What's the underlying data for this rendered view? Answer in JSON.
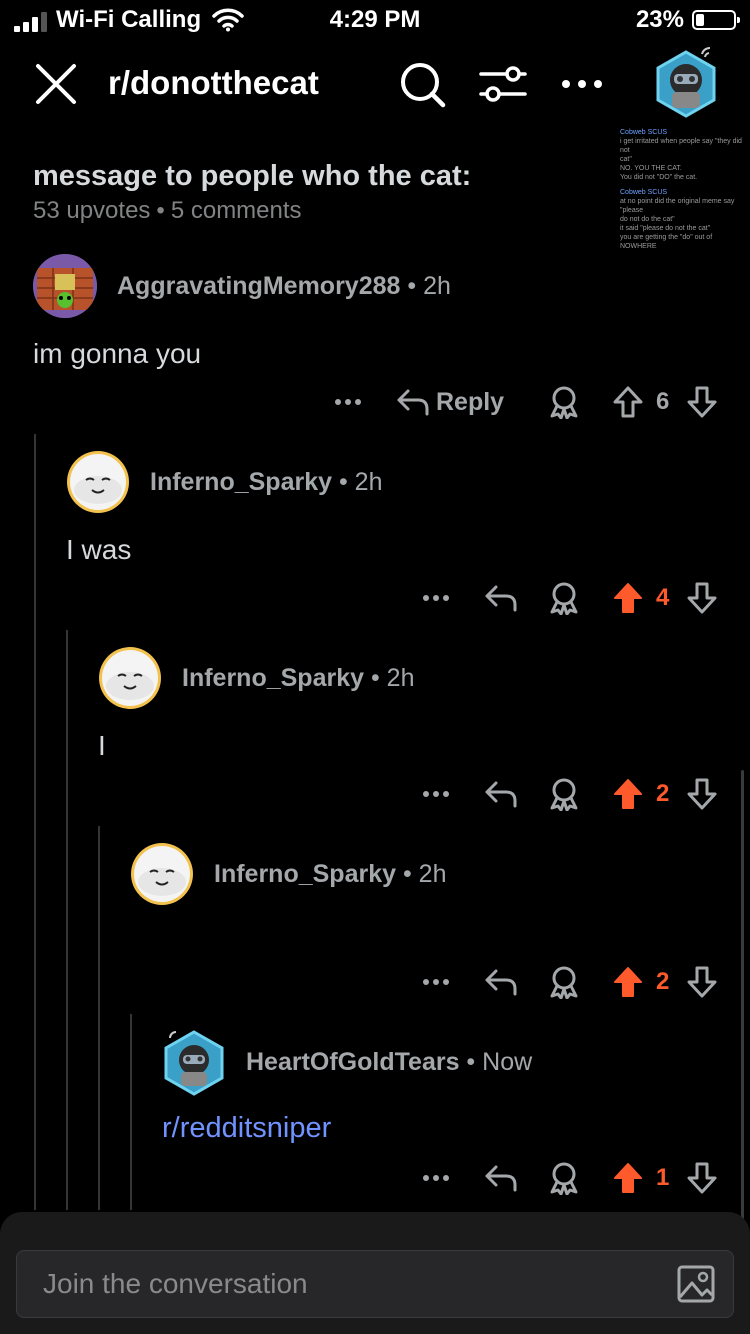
{
  "status_bar": {
    "carrier": "Wi-Fi Calling",
    "time": "4:29 PM",
    "battery": "23%"
  },
  "header": {
    "subreddit": "r/donotthecat"
  },
  "post": {
    "title": "message to people who the cat:",
    "upvotes": "53 upvotes",
    "comments": "5 comments",
    "thumbnail": {
      "lines": [
        "Cobweb  SCUS",
        "i get irritated when people say \"they did not",
        "cat\"",
        "NO. YOU THE CAT.",
        "You did not \"DO\" the cat.",
        "Cobweb  SCUS",
        "at no point did the original meme say \"please",
        "do not do the cat\"",
        "it said \"please do not the cat\"",
        "you are getting the \"do\" out of NOWHERE"
      ]
    }
  },
  "comments": [
    {
      "user": "AggravatingMemory288",
      "time": "2h",
      "body": "im gonna you",
      "reply_label": "Reply",
      "score": "6"
    },
    {
      "user": "Inferno_Sparky",
      "time": "2h",
      "body": "I was",
      "score": "4"
    },
    {
      "user": "Inferno_Sparky",
      "time": "2h",
      "body": "I",
      "score": "2"
    },
    {
      "user": "Inferno_Sparky",
      "time": "2h",
      "body": "",
      "score": "2"
    },
    {
      "user": "HeartOfGoldTears",
      "time": "Now",
      "body": "r/redditsniper",
      "score": "1"
    }
  ],
  "composer": {
    "placeholder": "Join the conversation"
  },
  "colors": {
    "upvoted": "#ff5a2c",
    "link": "#7193ff",
    "muted": "#a4a8ab"
  }
}
